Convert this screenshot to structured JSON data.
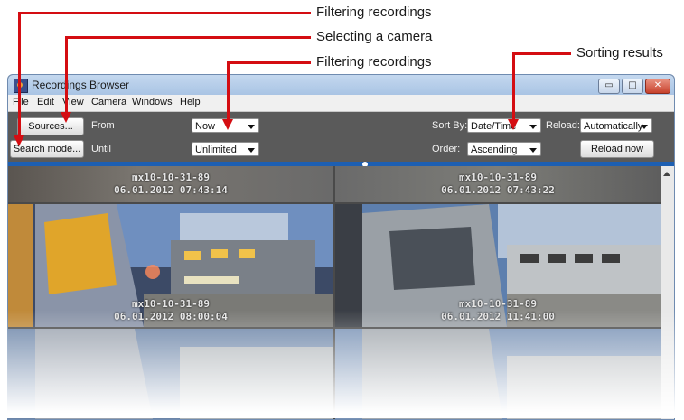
{
  "callouts": [
    {
      "label": "Filtering recordings"
    },
    {
      "label": "Selecting a camera"
    },
    {
      "label": "Filtering recordings"
    },
    {
      "label": "Sorting results"
    }
  ],
  "window": {
    "title": "Recordings Browser",
    "controls": {
      "minimize": "▭",
      "maximize": "□",
      "close": "✕"
    }
  },
  "menu": [
    "File",
    "Edit",
    "View",
    "Camera",
    "Windows",
    "Help"
  ],
  "toolbar": {
    "sources_button": "Sources...",
    "search_mode_button": "Search mode...",
    "from_label": "From",
    "from_value": "Now",
    "until_label": "Until",
    "until_value": "Unlimited",
    "sort_by_label": "Sort By:",
    "sort_by_value": "Date/Time",
    "reload_label": "Reload:",
    "reload_value": "Automatically",
    "order_label": "Order:",
    "order_value": "Ascending",
    "reload_now_button": "Reload now"
  },
  "recordings": [
    {
      "camera": "mx10-10-31-89",
      "timestamp": "06.01.2012 07:43:14"
    },
    {
      "camera": "mx10-10-31-89",
      "timestamp": "06.01.2012 07:43:22"
    },
    {
      "camera": "mx10-10-31-89",
      "timestamp": "06.01.2012 08:00:04"
    },
    {
      "camera": "mx10-10-31-89",
      "timestamp": "06.01.2012 11:41:00"
    }
  ],
  "colors": {
    "callout_red": "#d40d12",
    "toolbar_bg": "#5a5a5a",
    "accent_blue": "#1d5fb2"
  }
}
